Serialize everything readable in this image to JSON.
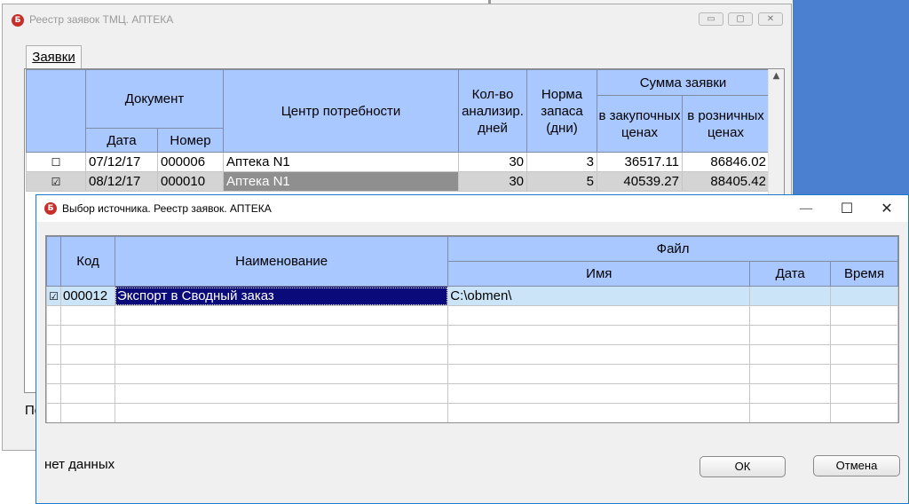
{
  "bg_window": {
    "title": "Реестр заявок ТМЦ. АПТЕКА",
    "icon_letter": "Б",
    "controls": {
      "minimize": "▭",
      "maximize": "▢",
      "close": "✕"
    },
    "tab": "Заявки",
    "grid": {
      "headers": {
        "document": "Документ",
        "date": "Дата",
        "number": "Номер",
        "center": "Центр потребности",
        "days": "Кол-во анализир. дней",
        "stock": "Норма запаса (дни)",
        "sum": "Сумма заявки",
        "purchase": "в закупочных ценах",
        "retail": "в розничных ценах"
      },
      "rows": [
        {
          "check": "☐",
          "date": "07/12/17",
          "number": "000006",
          "center": "Аптека N1",
          "days": "30",
          "stock": "3",
          "purchase": "36517.11",
          "retail": "86846.02"
        },
        {
          "check": "☑",
          "date": "08/12/17",
          "number": "000010",
          "center": "Аптека N1",
          "days": "30",
          "stock": "5",
          "purchase": "40539.27",
          "retail": "88405.42"
        }
      ]
    },
    "footer_label": "Пе"
  },
  "dialog": {
    "title": "Выбор источника. Реестр заявок.  АПТЕКА",
    "icon_letter": "Б",
    "controls": {
      "minimize": "—",
      "maximize": "☐",
      "close": "✕"
    },
    "grid": {
      "headers": {
        "code": "Код",
        "name": "Наименование",
        "file": "Файл",
        "file_name": "Имя",
        "date": "Дата",
        "time": "Время"
      },
      "rows": [
        {
          "check": "☑",
          "code": "000012",
          "name": "Экспорт в Сводный заказ",
          "file_name": "C:\\obmen\\",
          "date": "",
          "time": ""
        }
      ]
    },
    "status": "нет данных",
    "ok_label": "ОК",
    "cancel_label": "Отмена"
  }
}
